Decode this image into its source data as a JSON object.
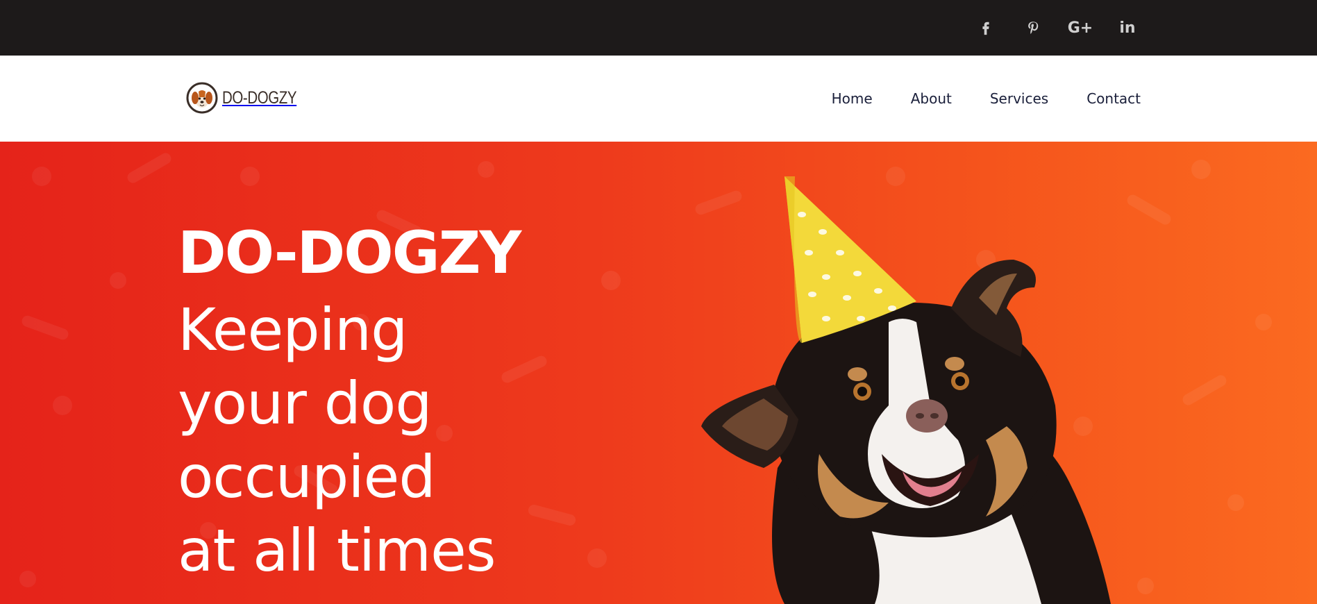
{
  "social": {
    "facebook_icon": "facebook-icon",
    "pinterest_icon": "pinterest-icon",
    "googleplus_label": "G+",
    "linkedin_label": "in"
  },
  "header": {
    "logo_text": "DO-DOGZY",
    "nav": [
      {
        "label": "Home"
      },
      {
        "label": "About"
      },
      {
        "label": "Services"
      },
      {
        "label": "Contact"
      }
    ]
  },
  "hero": {
    "title": "DO-DOGZY",
    "subtitle_lines": [
      "Keeping",
      "your dog",
      "occupied",
      "at all times"
    ]
  },
  "colors": {
    "topbar": "#1d1a1a",
    "hero_start": "#e5231a",
    "hero_end": "#fb6a20",
    "nav_text": "#1a1f3a"
  }
}
